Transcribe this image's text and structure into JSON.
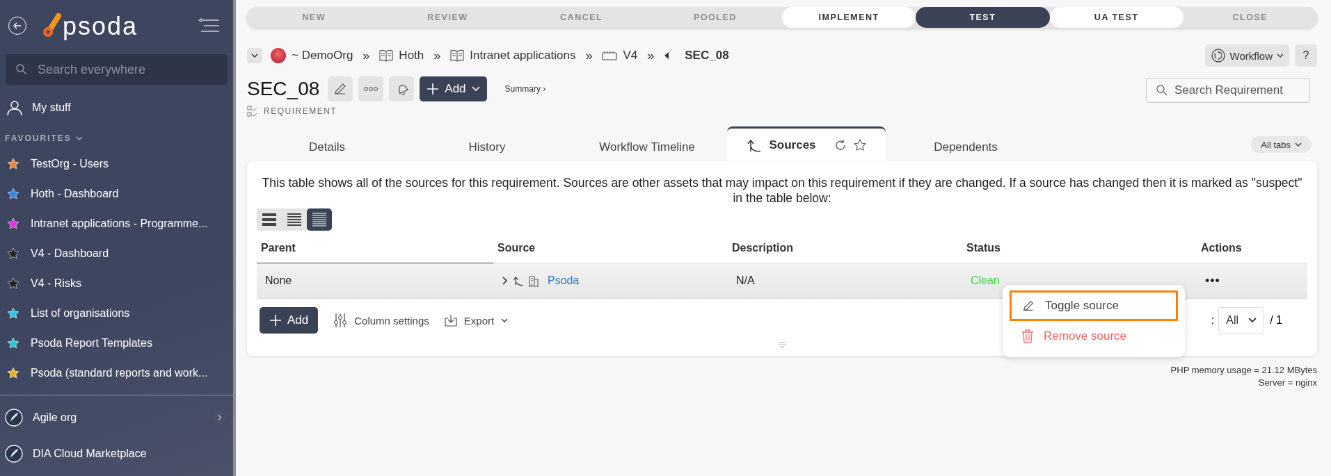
{
  "sidebar": {
    "logo": "psoda",
    "search": {
      "placeholder": "Search everywhere"
    },
    "my_stuff": "My stuff",
    "favourites_heading": "FAVOURITES",
    "favourites": [
      {
        "label": "TestOrg - Users",
        "color": "#f5843c"
      },
      {
        "label": "Hoth - Dashboard",
        "color": "#2f86e8"
      },
      {
        "label": "Intranet applications - Programme...",
        "color": "#e02ee0"
      },
      {
        "label": "V4 - Dashboard",
        "color": "#222222"
      },
      {
        "label": "V4 - Risks",
        "color": "#222222"
      },
      {
        "label": "List of organisations",
        "color": "#2ec5e0"
      },
      {
        "label": "Psoda Report Templates",
        "color": "#2ec5e0"
      },
      {
        "label": "Psoda (standard reports and work...",
        "color": "#e6b820"
      }
    ],
    "organisations": [
      {
        "label": "Agile org",
        "expandable": true
      },
      {
        "label": "DIA Cloud Marketplace",
        "expandable": false
      }
    ]
  },
  "workflow_stages": [
    {
      "label": "NEW",
      "selected": false,
      "available": false
    },
    {
      "label": "REVIEW",
      "selected": false,
      "available": false
    },
    {
      "label": "CANCEL",
      "selected": false,
      "available": false
    },
    {
      "label": "POOLED",
      "selected": false,
      "available": false
    },
    {
      "label": "IMPLEMENT",
      "selected": false,
      "available": true
    },
    {
      "label": "TEST",
      "selected": true,
      "available": false
    },
    {
      "label": "UA TEST",
      "selected": false,
      "available": true
    },
    {
      "label": "CLOSE",
      "selected": false,
      "available": false
    }
  ],
  "breadcrumb": [
    {
      "label": "~ DemoOrg",
      "kind": "org"
    },
    {
      "label": "Hoth",
      "kind": "book"
    },
    {
      "label": "Intranet applications",
      "kind": "book"
    },
    {
      "label": "V4",
      "kind": "board"
    },
    {
      "label": "SEC_08",
      "kind": "current"
    }
  ],
  "breadcrumb_separator": "»",
  "workflow_button": "Workflow",
  "help_button": "?",
  "title": "SEC_08",
  "add_button": "Add",
  "summary_link": "Summary ›",
  "asset_type": "REQUIREMENT",
  "search_requirements": {
    "placeholder": "Search Requirement"
  },
  "tabs": [
    {
      "label": "Details",
      "selected": false
    },
    {
      "label": "History",
      "selected": false
    },
    {
      "label": "Workflow Timeline",
      "selected": false
    },
    {
      "label": "Sources",
      "selected": true
    },
    {
      "label": "Dependents",
      "selected": false
    }
  ],
  "all_tabs_button": "All tabs",
  "description": "This table shows all of the sources for this requirement. Sources are other assets that may impact on this requirement if they are changed. If a source has changed then it is marked as \"suspect\" in the table below:",
  "view_modes": [
    {
      "kind": "large",
      "selected": false
    },
    {
      "kind": "medium",
      "selected": false
    },
    {
      "kind": "compact",
      "selected": true
    }
  ],
  "table": {
    "columns": [
      "Parent",
      "Source",
      "Description",
      "Status",
      "Actions"
    ],
    "rows": [
      {
        "parent": "None",
        "source": "Psoda",
        "description": "N/A",
        "status": "Clean",
        "actions": "•••"
      }
    ]
  },
  "footer_actions": {
    "add": "Add",
    "column_settings": "Column settings",
    "export": "Export"
  },
  "pager": {
    "label": ":",
    "page_size": "All",
    "total": "/ 1"
  },
  "context_menu": [
    {
      "label": "Toggle source",
      "kind": "edit",
      "highlighted": true
    },
    {
      "label": "Remove source",
      "kind": "delete",
      "highlighted": false
    }
  ],
  "server_info": [
    "PHP memory usage = 21.12 MBytes",
    "Server = nginx"
  ]
}
